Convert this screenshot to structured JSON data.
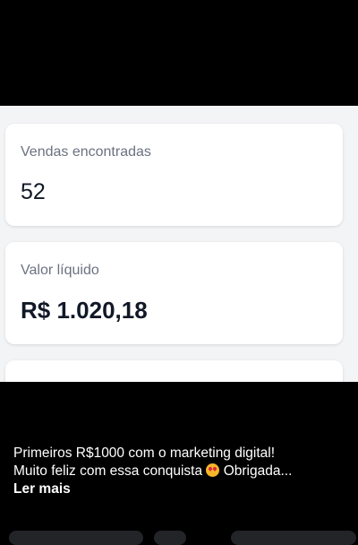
{
  "cards": [
    {
      "label": "Vendas encontradas",
      "value": "52"
    },
    {
      "label": "Valor líquido",
      "value": "R$ 1.020,18"
    }
  ],
  "caption": {
    "line1": "Primeiros R$1000 com o marketing digital!",
    "line2_before": "Muito feliz com essa conquista",
    "line2_after": "Obrigada...",
    "emoji": "heart-eyes-emoji",
    "read_more": "Ler mais"
  },
  "colors": {
    "background": "#000000",
    "app_background": "#f3f4f6",
    "card": "#ffffff",
    "label": "#6b7280",
    "value": "#111827"
  }
}
